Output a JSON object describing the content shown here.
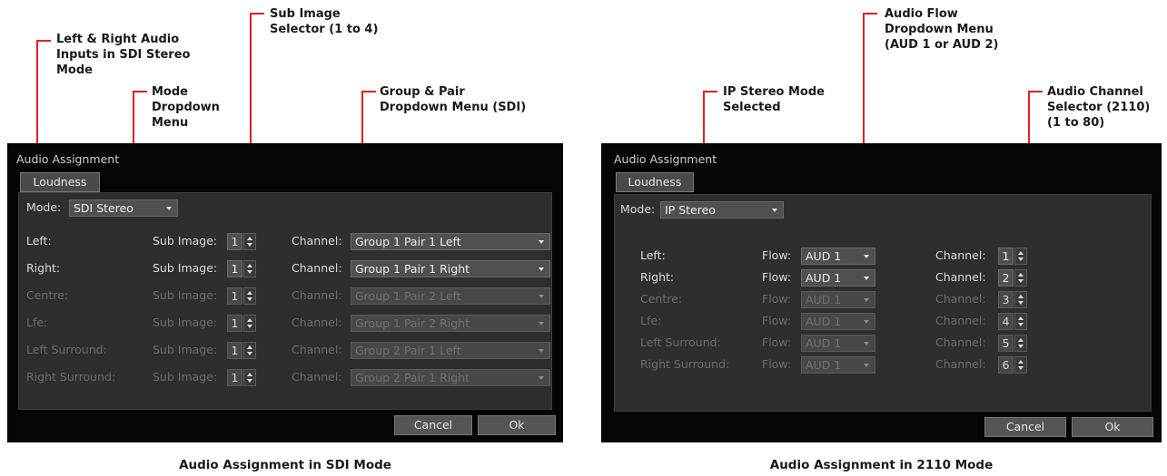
{
  "left": {
    "annotations": {
      "lr_inputs": "Left & Right Audio\nInputs in SDI Stereo\nMode",
      "mode_dropdown": "Mode\nDropdown\nMenu",
      "sub_image": "Sub Image\nSelector (1 to 4)",
      "group_pair": "Group & Pair\nDropdown Menu (SDI)"
    },
    "dialog": {
      "title": "Audio Assignment",
      "tab": "Loudness",
      "mode_label": "Mode:",
      "mode_value": "SDI Stereo",
      "sub_image_label": "Sub Image:",
      "channel_label": "Channel:",
      "rows": [
        {
          "name": "Left:",
          "sub": "1",
          "channel": "Group 1 Pair 1 Left"
        },
        {
          "name": "Right:",
          "sub": "1",
          "channel": "Group 1 Pair 1 Right"
        },
        {
          "name": "Centre:",
          "sub": "1",
          "channel": "Group 1 Pair 2 Left"
        },
        {
          "name": "Lfe:",
          "sub": "1",
          "channel": "Group 1 Pair 2 Right"
        },
        {
          "name": "Left Surround:",
          "sub": "1",
          "channel": "Group 2 Pair 1 Left"
        },
        {
          "name": "Right Surround:",
          "sub": "1",
          "channel": "Group 2 Pair 1 Right"
        }
      ],
      "cancel": "Cancel",
      "ok": "Ok"
    },
    "caption": "Audio Assignment in SDI Mode"
  },
  "right": {
    "annotations": {
      "ip_stereo": "IP Stereo Mode\nSelected",
      "audio_flow": "Audio Flow\nDropdown Menu\n(AUD 1 or AUD 2)",
      "audio_channel": "Audio Channel\nSelector (2110)\n(1 to 80)"
    },
    "dialog": {
      "title": "Audio Assignment",
      "tab": "Loudness",
      "mode_label": "Mode:",
      "mode_value": "IP Stereo",
      "flow_label": "Flow:",
      "channel_label": "Channel:",
      "rows": [
        {
          "name": "Left:",
          "flow": "AUD 1",
          "channel": "1"
        },
        {
          "name": "Right:",
          "flow": "AUD 1",
          "channel": "2"
        },
        {
          "name": "Centre:",
          "flow": "AUD 1",
          "channel": "3"
        },
        {
          "name": "Lfe:",
          "flow": "AUD 1",
          "channel": "4"
        },
        {
          "name": "Left Surround:",
          "flow": "AUD 1",
          "channel": "5"
        },
        {
          "name": "Right Surround:",
          "flow": "AUD 1",
          "channel": "6"
        }
      ],
      "cancel": "Cancel",
      "ok": "Ok"
    },
    "caption": "Audio Assignment in 2110 Mode"
  },
  "colors": {
    "callout": "#e02020",
    "dialog_bg": "#050505",
    "panel_bg": "#2e2e2e"
  }
}
